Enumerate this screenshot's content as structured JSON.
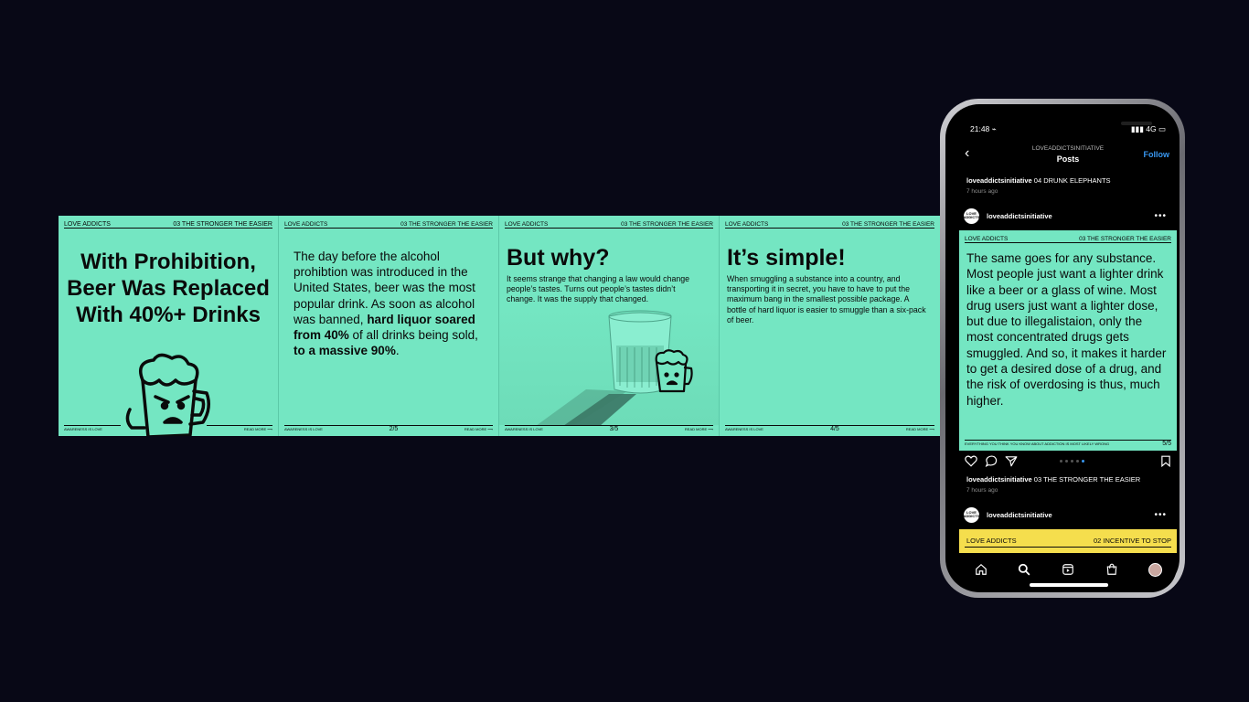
{
  "strip": {
    "slide1": {
      "brand": "LOVE ADDICTS",
      "series": "03  THE STRONGER THE EASIER",
      "title": "With Prohibition, Beer Was Replaced With 40%+ Drinks",
      "foot_left": "AWARENESS IS LOVE",
      "foot_right": "READ MORE ⟶"
    },
    "slide2": {
      "brand": "LOVE ADDICTS",
      "series": "03  THE STRONGER THE EASIER",
      "body_plain1": "The day before the alcohol prohibtion was introduced in the United States, beer was the most popular drink. As soon as alcohol was banned, ",
      "body_bold1": "hard liquor soared from 40%",
      "body_plain2": " of all drinks being sold, ",
      "body_bold2": "to a massive 90%",
      "body_plain3": ".",
      "foot_left": "AWARENESS IS LOVE",
      "page": "2/5",
      "foot_right": "READ MORE ⟶"
    },
    "slide3": {
      "brand": "LOVE ADDICTS",
      "series": "03  THE STRONGER THE EASIER",
      "heading": "But why?",
      "body": "It seems strange that changing a law would change people’s tastes. Turns out people’s tastes didn’t change. It was the supply that changed.",
      "foot_left": "AWARENESS IS LOVE",
      "page": "3/5",
      "foot_right": "READ MORE ⟶"
    },
    "slide4": {
      "brand": "LOVE ADDICTS",
      "series": "03  THE STRONGER THE EASIER",
      "heading": "It’s simple!",
      "body": "When smuggling a substance into a country, and transporting it in secret, you have to have to put the maximum bang in the smallest possible package. A bottle of hard liquor is easier to smuggle than a six-pack of beer.",
      "foot_left": "AWARENESS IS LOVE",
      "page": "4/5",
      "foot_right": "READ MORE ⟶"
    }
  },
  "phone": {
    "status_time": "21:48 ⌁",
    "status_network": "▮▮▮ 4G ▭",
    "nav_account": "LOVEADDICTSINITIATIVE",
    "nav_title": "Posts",
    "follow": "Follow",
    "prev_caption_user": "loveaddictsinitiative",
    "prev_caption_text": " 04 DRUNK ELEPHANTS",
    "prev_time": "7 hours ago",
    "avatar_text": "LOVE ADDICTS",
    "post_user": "loveaddictsinitiative",
    "post": {
      "brand": "LOVE ADDICTS",
      "series": "03  THE STRONGER THE EASIER",
      "body": "The same goes for any substance. Most people just want a lighter drink like a beer or a glass of wine. Most drug users just want a lighter dose, but due to illegalistaion, only the most concentrated drugs gets smuggled. And so, it makes it harder to get a desired dose of a drug, and the risk of overdosing is thus, much higher.",
      "foot_left": "EVERYTHING YOU THINK YOU KNOW ABOUT ADDICTION IS MOST LIKELY WRONG",
      "page": "5/5"
    },
    "caption_user": "loveaddictsinitiative",
    "caption_text": " 03 THE STRONGER THE EASIER",
    "caption_time": "7 hours ago",
    "next_user": "loveaddictsinitiative",
    "next_post": {
      "brand": "LOVE ADDICTS",
      "series": "02 INCENTIVE TO STOP"
    },
    "tabs": [
      "home-icon",
      "search-icon",
      "reels-icon",
      "shop-icon",
      "profile-avatar"
    ],
    "colors": {
      "slide_green": "#74e6c2",
      "yellow": "#f5de4d",
      "follow_blue": "#3897f0",
      "background": "#080816"
    }
  }
}
